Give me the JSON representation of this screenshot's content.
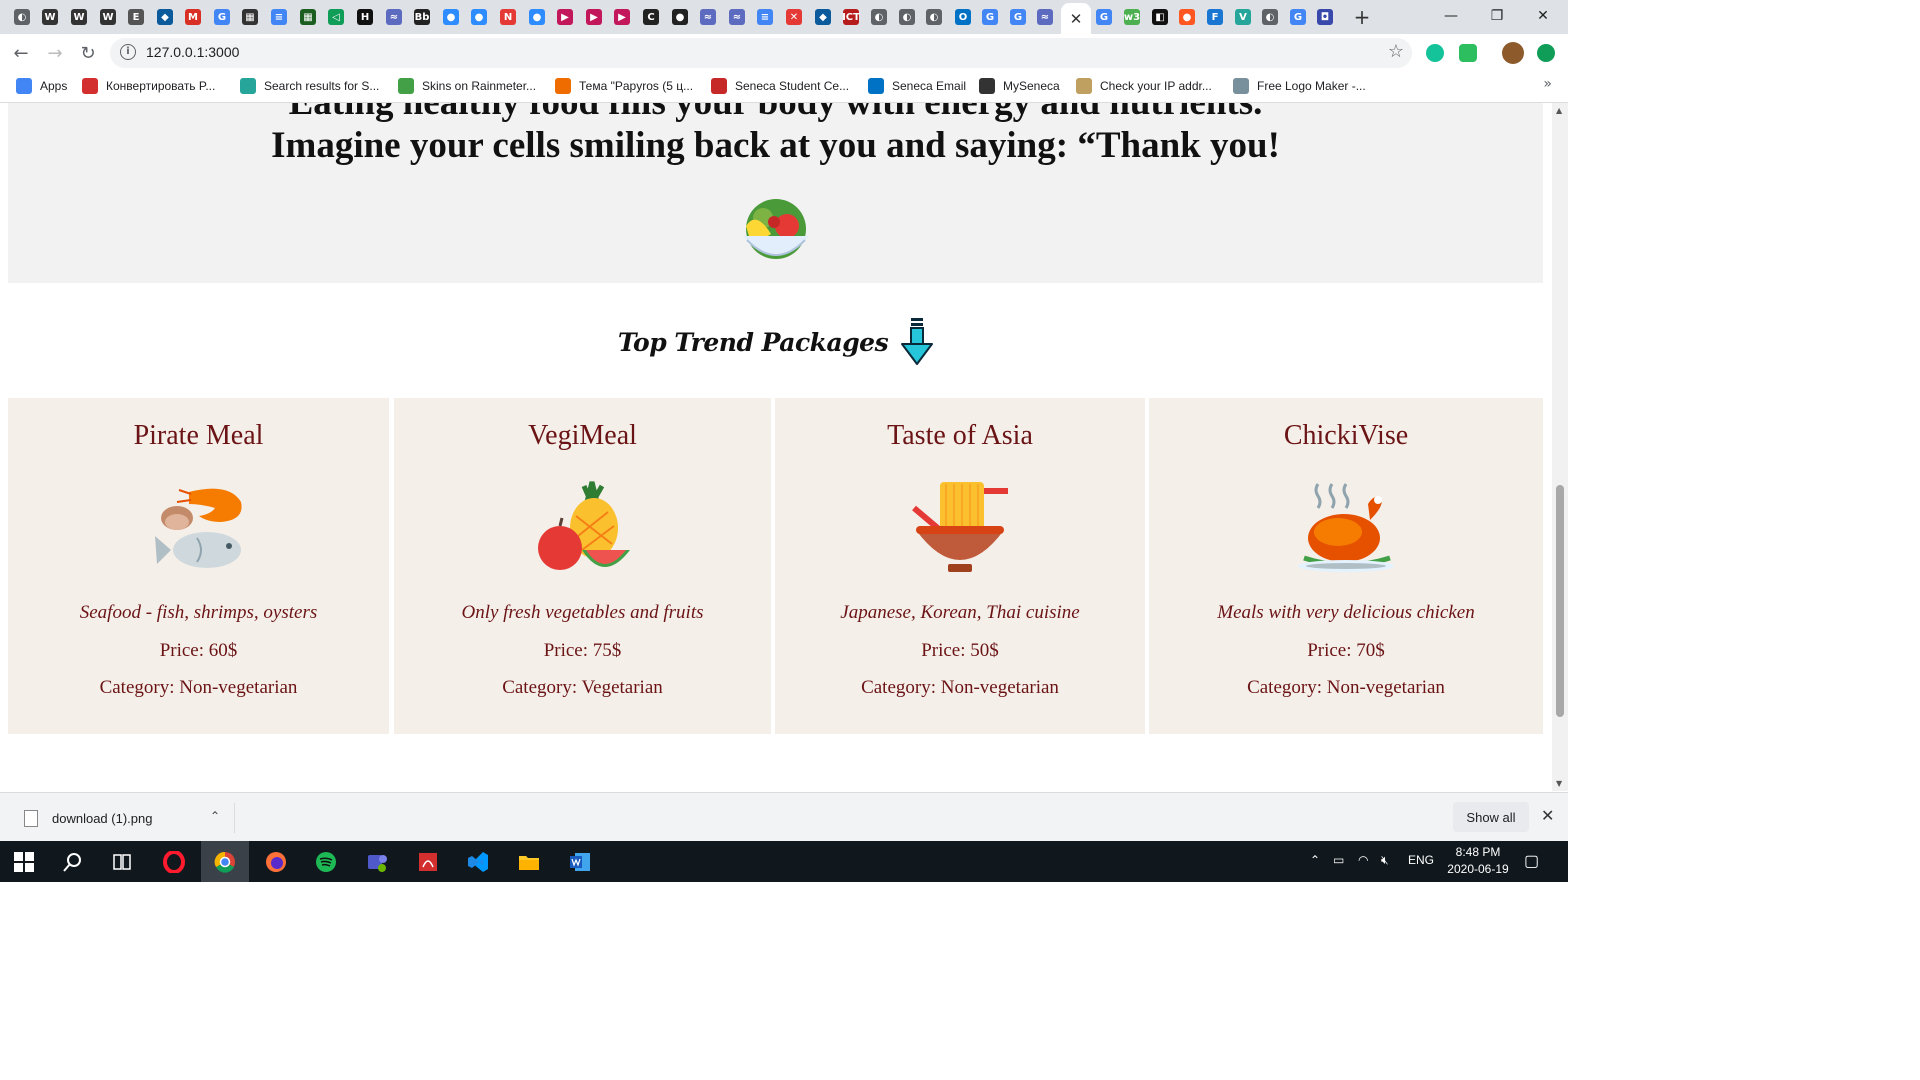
{
  "browser": {
    "url": "127.0.0.1:3000",
    "tabs": [
      {
        "icon": "globe-icon",
        "glyph": "◐",
        "color": "#5f6368"
      },
      {
        "icon": "wikipedia-icon",
        "glyph": "W",
        "color": "#333"
      },
      {
        "icon": "wikipedia-icon",
        "glyph": "W",
        "color": "#333"
      },
      {
        "icon": "wikipedia-icon",
        "glyph": "W",
        "color": "#333"
      },
      {
        "icon": "document-icon",
        "glyph": "E",
        "color": "#555"
      },
      {
        "icon": "app-icon",
        "glyph": "◆",
        "color": "#0a5a9c"
      },
      {
        "icon": "gmail-icon",
        "glyph": "M",
        "color": "#d93025"
      },
      {
        "icon": "translate-icon",
        "glyph": "G",
        "color": "#4285f4"
      },
      {
        "icon": "image-icon",
        "glyph": "▦",
        "color": "#333"
      },
      {
        "icon": "docs-icon",
        "glyph": "≡",
        "color": "#4285f4"
      },
      {
        "icon": "app-icon",
        "glyph": "▦",
        "color": "#1b5e20"
      },
      {
        "icon": "app-icon",
        "glyph": "◁",
        "color": "#0f9d58"
      },
      {
        "icon": "hackerrank-icon",
        "glyph": "H",
        "color": "#111"
      },
      {
        "icon": "app-icon",
        "glyph": "≈",
        "color": "#5c6bc0"
      },
      {
        "icon": "blackboard-icon",
        "glyph": "Bb",
        "color": "#222"
      },
      {
        "icon": "zoom-icon",
        "glyph": "●",
        "color": "#2d8cff"
      },
      {
        "icon": "zoom-icon",
        "glyph": "●",
        "color": "#2d8cff"
      },
      {
        "icon": "app-icon",
        "glyph": "N",
        "color": "#e53935"
      },
      {
        "icon": "zoom-icon",
        "glyph": "●",
        "color": "#2d8cff"
      },
      {
        "icon": "media-icon",
        "glyph": "▶",
        "color": "#c2185b"
      },
      {
        "icon": "media-icon",
        "glyph": "▶",
        "color": "#c2185b"
      },
      {
        "icon": "media-icon",
        "glyph": "▶",
        "color": "#c2185b"
      },
      {
        "icon": "app-icon",
        "glyph": "C",
        "color": "#222"
      },
      {
        "icon": "github-icon",
        "glyph": "●",
        "color": "#222"
      },
      {
        "icon": "app-icon",
        "glyph": "≈",
        "color": "#5c6bc0"
      },
      {
        "icon": "app-icon",
        "glyph": "≈",
        "color": "#5c6bc0"
      },
      {
        "icon": "docs-icon",
        "glyph": "≡",
        "color": "#4285f4"
      },
      {
        "icon": "app-icon",
        "glyph": "✕",
        "color": "#e53935"
      },
      {
        "icon": "app-icon",
        "glyph": "◆",
        "color": "#0a5a9c"
      },
      {
        "icon": "app-icon",
        "glyph": "ICT",
        "color": "#b71c1c"
      },
      {
        "icon": "globe-icon",
        "glyph": "◐",
        "color": "#5f6368"
      },
      {
        "icon": "globe-icon",
        "glyph": "◐",
        "color": "#5f6368"
      },
      {
        "icon": "globe-icon",
        "glyph": "◐",
        "color": "#5f6368"
      },
      {
        "icon": "outlook-icon",
        "glyph": "O",
        "color": "#0072c6"
      },
      {
        "icon": "google-icon",
        "glyph": "G",
        "color": "#4285f4"
      },
      {
        "icon": "google-icon",
        "glyph": "G",
        "color": "#4285f4"
      },
      {
        "icon": "app-icon",
        "glyph": "≈",
        "color": "#5c6bc0"
      },
      {
        "icon": "close-icon",
        "glyph": "✕",
        "color": "#333",
        "active": true
      },
      {
        "icon": "google-icon",
        "glyph": "G",
        "color": "#4285f4"
      },
      {
        "icon": "app-icon",
        "glyph": "w3",
        "color": "#4caf50"
      },
      {
        "icon": "app-icon",
        "glyph": "◧",
        "color": "#111"
      },
      {
        "icon": "app-icon",
        "glyph": "●",
        "color": "#ff5722"
      },
      {
        "icon": "app-icon",
        "glyph": "F",
        "color": "#1976d2"
      },
      {
        "icon": "vuetify-icon",
        "glyph": "V",
        "color": "#26a69a"
      },
      {
        "icon": "globe-icon",
        "glyph": "◐",
        "color": "#5f6368"
      },
      {
        "icon": "google-icon",
        "glyph": "G",
        "color": "#4285f4"
      },
      {
        "icon": "app-icon",
        "glyph": "◘",
        "color": "#3949ab"
      }
    ],
    "bookmarks": [
      {
        "label": "Apps",
        "icon": "apps-grid-icon",
        "color": "#4285f4"
      },
      {
        "label": "Конвертировать P...",
        "icon": "convert-icon",
        "color": "#d32f2f"
      },
      {
        "label": "Search results for S...",
        "icon": "vuetify-icon",
        "color": "#26a69a"
      },
      {
        "label": "Skins on Rainmeter...",
        "icon": "rainmeter-icon",
        "color": "#43a047"
      },
      {
        "label": "Тема \"Papyros (5 ц...",
        "icon": "theme-icon",
        "color": "#ef6c00"
      },
      {
        "label": "Seneca Student Ce...",
        "icon": "seneca-icon",
        "color": "#c62828"
      },
      {
        "label": "Seneca Email",
        "icon": "outlook-icon",
        "color": "#0072c6"
      },
      {
        "label": "MySeneca",
        "icon": "blackboard-icon",
        "color": "#333"
      },
      {
        "label": "Check your IP addr...",
        "icon": "ip-icon",
        "color": "#c0a060"
      },
      {
        "label": "Free Logo Maker -...",
        "icon": "logo-maker-icon",
        "color": "#78909c"
      }
    ]
  },
  "page": {
    "intro_line1": "Eating healthy food fills your body with energy and nutrients.",
    "intro_line2": "Imagine your cells smiling back at you and saying: “Thank you!",
    "section_title": "Top Trend Packages",
    "packages": [
      {
        "title": "Pirate Meal",
        "description": "Seafood - fish, shrimps, oysters",
        "price": "Price: 60$",
        "category": "Category: Non-vegetarian",
        "icon": "seafood-icon"
      },
      {
        "title": "VegiMeal",
        "description": "Only fresh vegetables and fruits",
        "price": "Price: 75$",
        "category": "Category: Vegetarian",
        "icon": "fruit-icon"
      },
      {
        "title": "Taste of Asia",
        "description": "Japanese, Korean, Thai cuisine",
        "price": "Price: 50$",
        "category": "Category: Non-vegetarian",
        "icon": "noodles-icon"
      },
      {
        "title": "ChickiVise",
        "description": "Meals with very delicious chicken",
        "price": "Price: 70$",
        "category": "Category: Non-vegetarian",
        "icon": "roast-chicken-icon"
      }
    ],
    "colors": {
      "card_bg": "#f5efe9",
      "card_text": "#6b1416",
      "intro_bg": "#f2f2f2"
    }
  },
  "downloads": {
    "filename": "download (1).png",
    "show_all": "Show all"
  },
  "taskbar": {
    "lang": "ENG",
    "time": "8:48 PM",
    "date": "2020-06-19"
  }
}
